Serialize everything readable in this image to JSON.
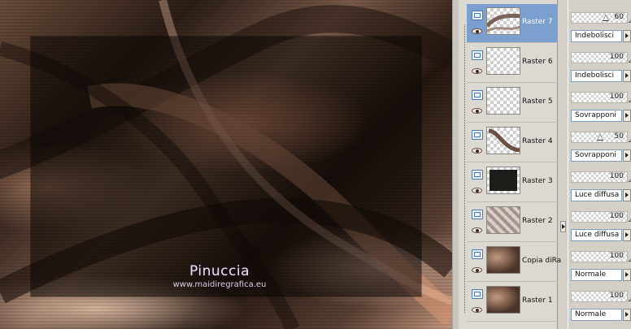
{
  "canvas": {
    "watermark_name": "Pinuccia",
    "watermark_url": "www.maidiregrafica.eu"
  },
  "layers": [
    {
      "name": "Raster 7",
      "selected": true,
      "thumb": "wave-brown-icon",
      "opacity": "60",
      "slider": 0.6,
      "blend": "Indebolisci"
    },
    {
      "name": "Raster 6",
      "selected": false,
      "thumb": "transparent",
      "opacity": "100",
      "blend": "Indebolisci"
    },
    {
      "name": "Raster 5",
      "selected": false,
      "thumb": "transparent",
      "opacity": "100",
      "blend": "Sovrapponi"
    },
    {
      "name": "Raster 4",
      "selected": false,
      "thumb": "curve-brown-icon",
      "opacity": "50",
      "slider": 0.5,
      "blend": "Sovrapponi"
    },
    {
      "name": "Raster 3",
      "selected": false,
      "thumb": "dark-fill",
      "opacity": "100",
      "blend": "Luce diffusa"
    },
    {
      "name": "Raster 2",
      "selected": false,
      "thumb": "pattern-brown",
      "opacity": "100",
      "blend": "Luce diffusa"
    },
    {
      "name": "Copia diRa",
      "selected": false,
      "thumb": "blur-brown",
      "opacity": "100",
      "blend": "Normale"
    },
    {
      "name": "Raster 1",
      "selected": false,
      "thumb": "blur-brown",
      "opacity": "100",
      "blend": "Normale"
    }
  ],
  "colors": {
    "selection": "#7b9fcf",
    "panel": "#dcd9d2"
  }
}
